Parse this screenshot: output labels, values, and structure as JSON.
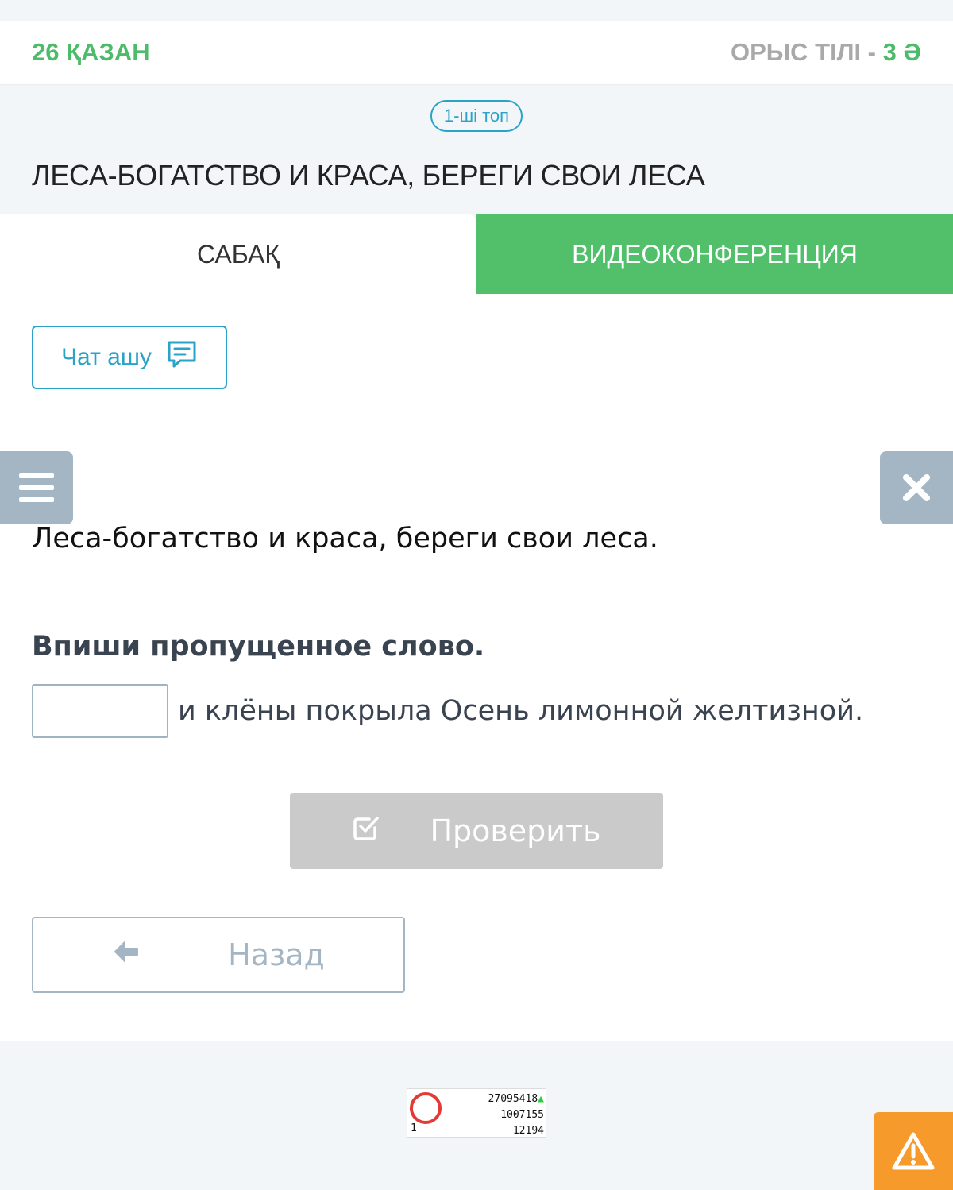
{
  "header": {
    "date": "26 ҚАЗАН",
    "subject": "ОРЫС ТІЛІ - ",
    "grade": "3 Ә"
  },
  "group_badge": "1-ші топ",
  "lesson_title": "ЛЕСА-БОГАТСТВО И КРАСА, БЕРЕГИ СВОИ ЛЕСА",
  "tabs": [
    {
      "label": "САБАҚ",
      "active": true
    },
    {
      "label": "ВИДЕОКОНФЕРЕНЦИЯ",
      "active": false
    }
  ],
  "chat_button": {
    "label": "Чат ашу",
    "icon": "chat-icon"
  },
  "task": {
    "heading": "Леса-богатство и краса, береги свои леса.",
    "instruction": "Впиши пропущенное слово.",
    "answer_value": "",
    "sentence_rest": "и клёны покрыла Осень лимонной желтизной."
  },
  "check_button": {
    "label": "Проверить",
    "icon": "check-square-icon"
  },
  "back_button": {
    "label": "Назад",
    "icon": "arrow-left-icon"
  },
  "counter": {
    "line1": "27095418",
    "line2": "1007155",
    "line3": "12194",
    "corner": "1"
  },
  "colors": {
    "accent_green": "#52c06b",
    "accent_blue": "#2aa3c9",
    "side_button": "#a4b6c4",
    "report_orange": "#f59a2b"
  }
}
